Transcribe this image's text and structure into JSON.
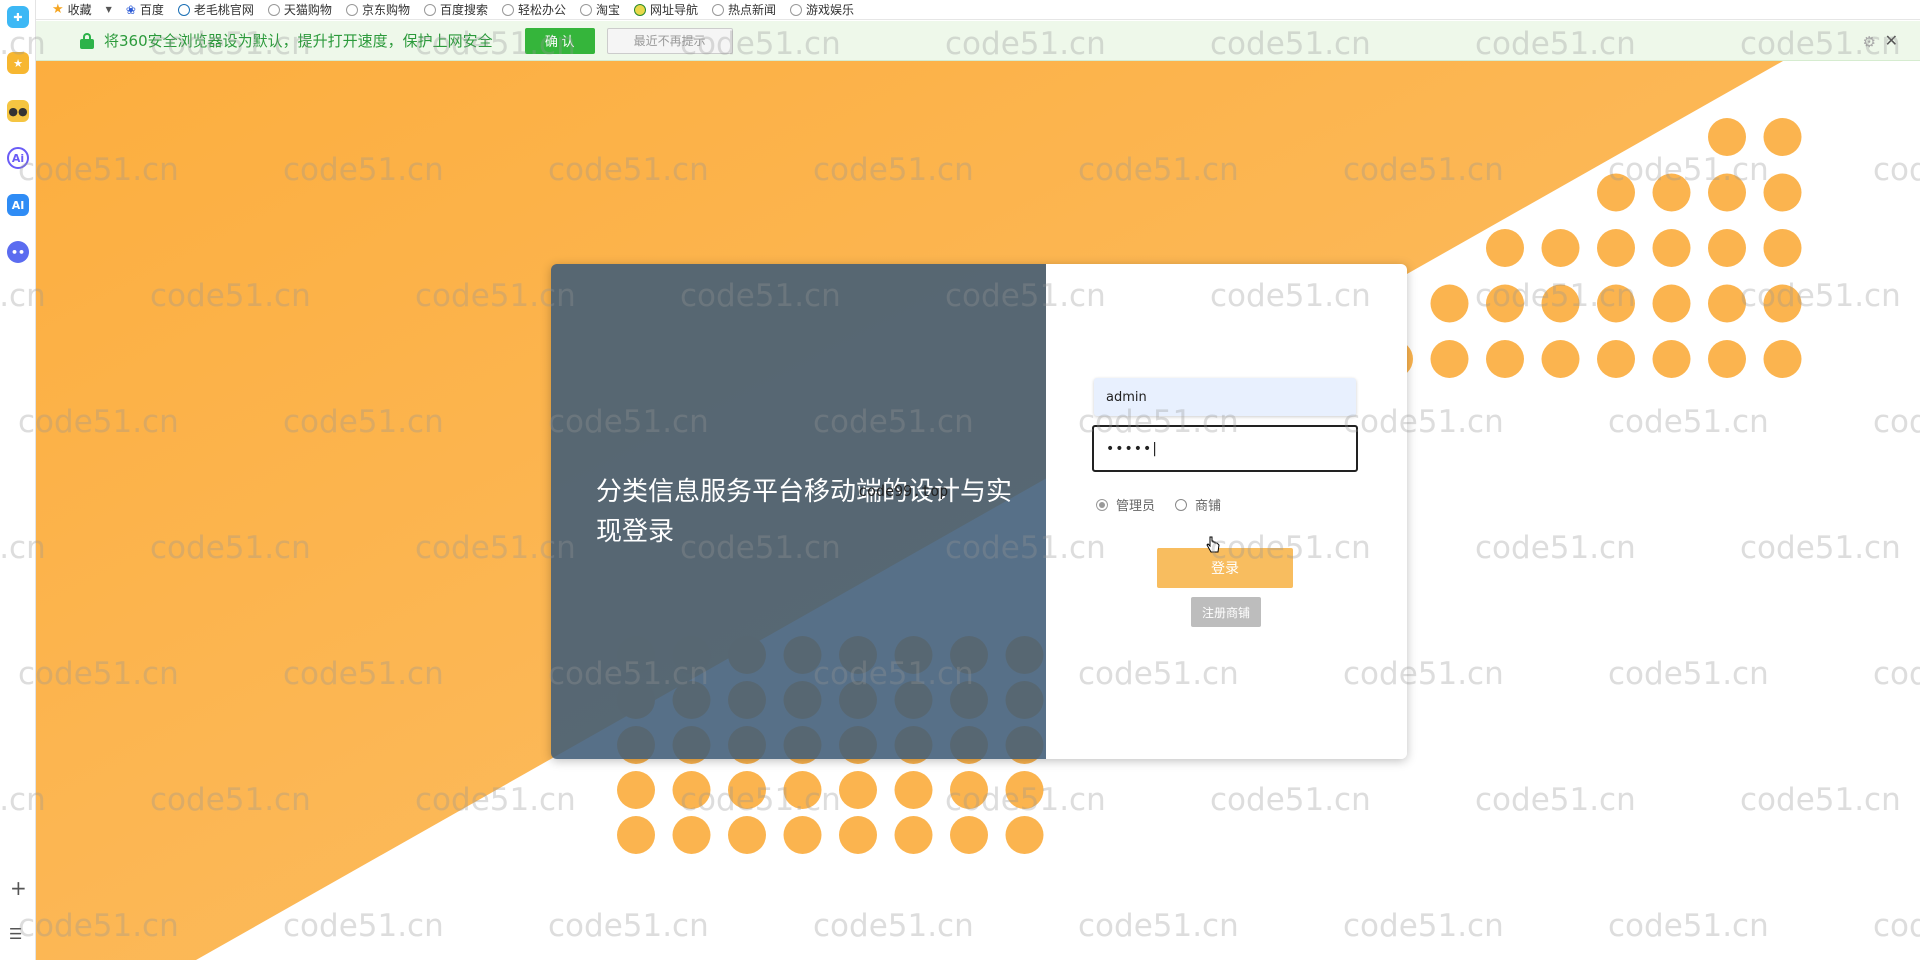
{
  "sidebar": {
    "icons": [
      {
        "name": "360-browser-logo-icon",
        "color": "#3db8f5"
      },
      {
        "name": "favorites-star-icon",
        "color": "#f7b731"
      },
      {
        "name": "robot-assistant-icon",
        "color": "#f5c542"
      },
      {
        "name": "ai-gradient-icon",
        "color": "#6a5cf6"
      },
      {
        "name": "ai-square-icon",
        "color": "#2f8cf5"
      },
      {
        "name": "chat-bot-icon",
        "color": "#5b6cf0"
      }
    ],
    "add": "+",
    "menu": "☰"
  },
  "bookmarks": {
    "items": [
      "收藏",
      "百度",
      "老毛桃官网",
      "天猫购物",
      "京东购物",
      "百度搜索",
      "轻松办公",
      "淘宝",
      "网址导航",
      "热点新闻",
      "游戏娱乐"
    ]
  },
  "notice": {
    "text": "将360安全浏览器设为默认，提升打开速度，保护上网安全",
    "ok_label": "确 认",
    "later_label": "最近不再提示",
    "close": "✕",
    "gear": "⚙"
  },
  "login": {
    "title": "分类信息服务平台移动端的设计与实现登录",
    "username_value": "admin",
    "password_value": "•••••|",
    "roles": [
      {
        "label": "管理员",
        "checked": true
      },
      {
        "label": "商铺",
        "checked": false
      }
    ],
    "login_label": "登录",
    "register_label": "注册商铺"
  },
  "overlay_text": "code99.top",
  "watermark_text": "code51.cn",
  "colors": {
    "orange": "#fbb44f",
    "card_left": "#405c78",
    "login_btn": "#f8bd5f"
  }
}
